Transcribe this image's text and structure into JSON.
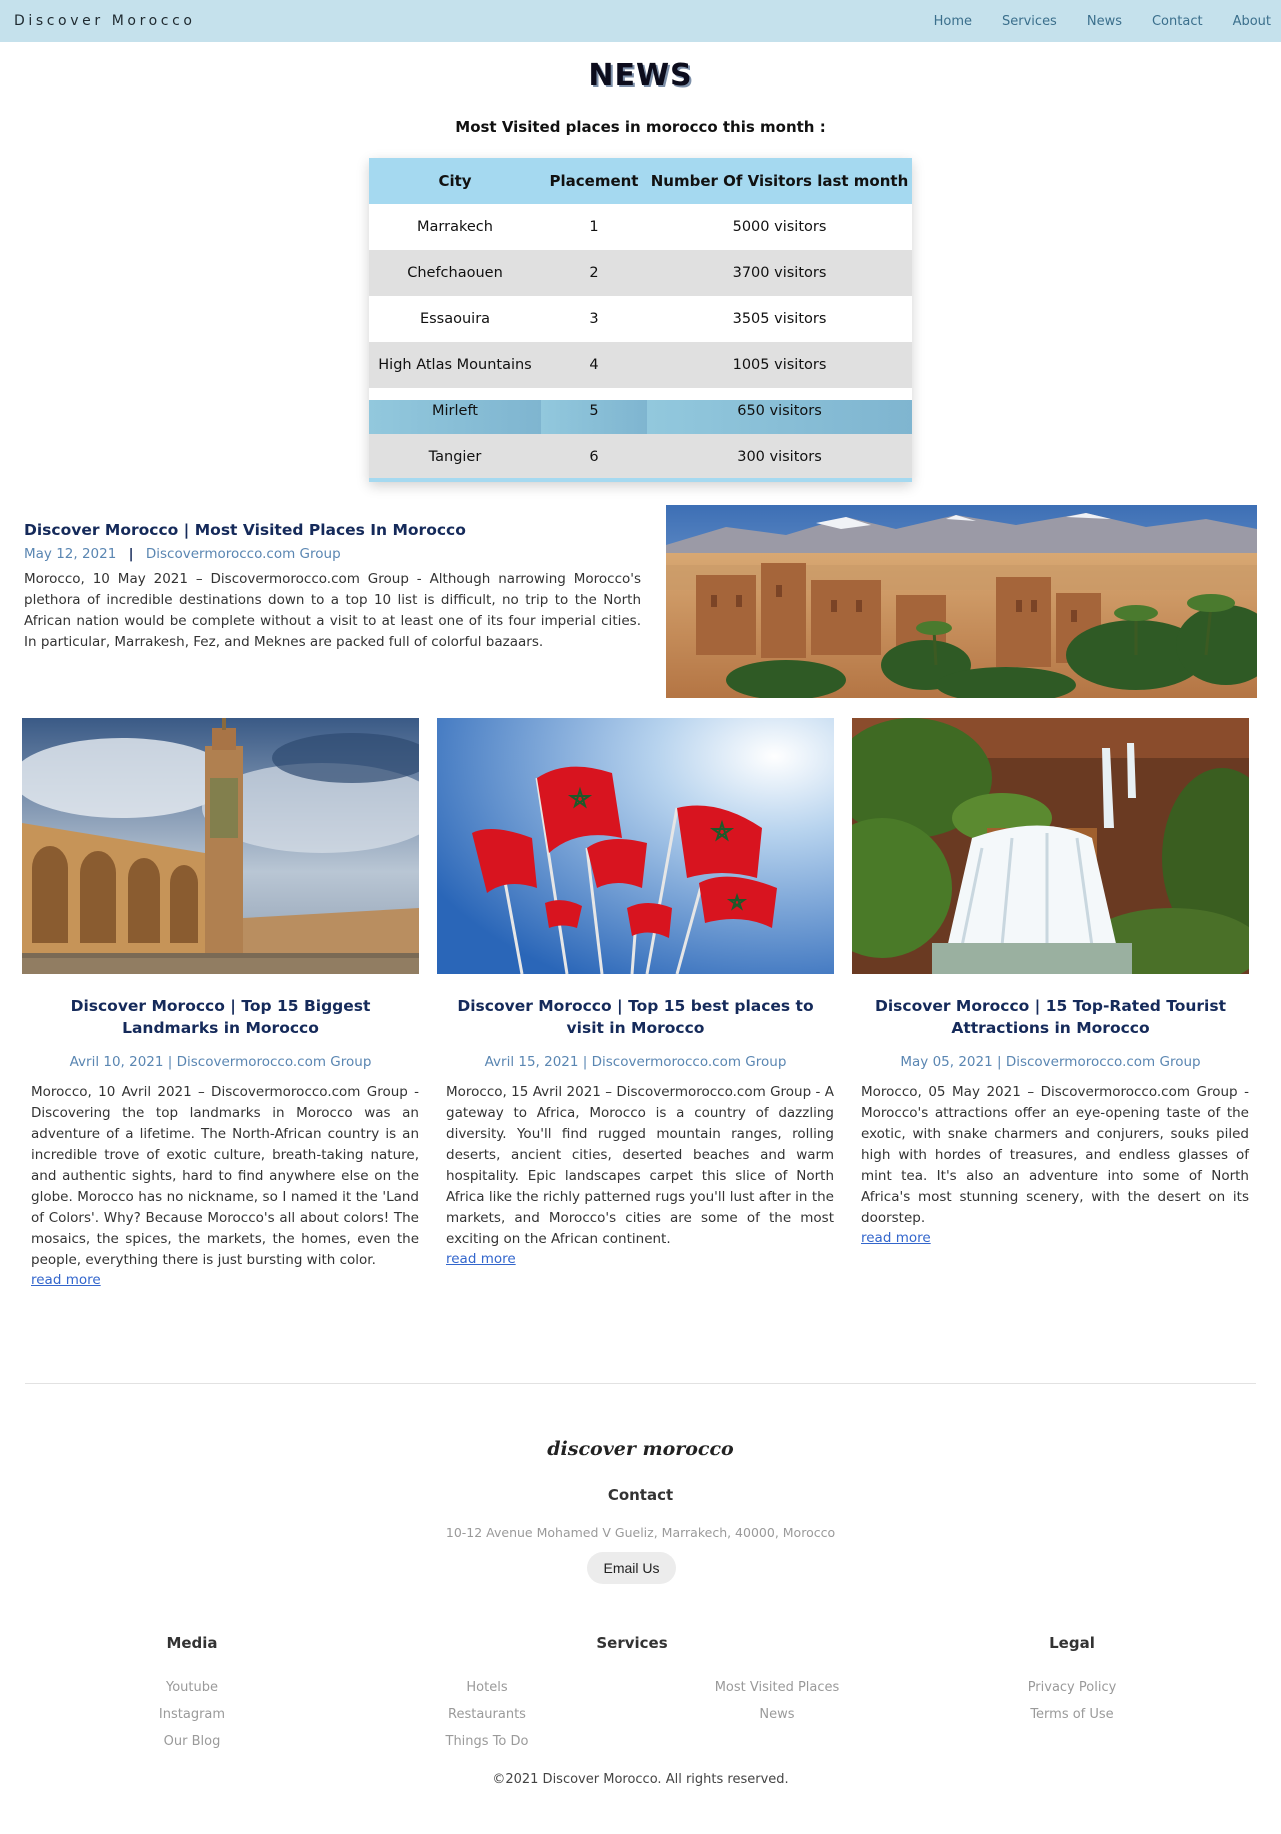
{
  "nav": {
    "brand": "Discover Morocco",
    "links": [
      "Home",
      "Services",
      "News",
      "Contact",
      "About"
    ]
  },
  "page": {
    "title": "NEWS",
    "subtitle": "Most Visited places in morocco this month :"
  },
  "table": {
    "headers": [
      "City",
      "Placement",
      "Number Of Visitors last month"
    ],
    "rows": [
      [
        "Marrakech",
        "1",
        "5000 visitors"
      ],
      [
        "Chefchaouen",
        "2",
        "3700 visitors"
      ],
      [
        "Essaouira",
        "3",
        "3505 visitors"
      ],
      [
        "High Atlas Mountains",
        "4",
        "1005 visitors"
      ],
      [
        "Mirleft",
        "5",
        "650 visitors"
      ],
      [
        "Tangier",
        "6",
        "300 visitors"
      ]
    ]
  },
  "feature": {
    "title": "Discover Morocco | Most Visited Places In Morocco",
    "date": "May 12, 2021",
    "separator": "|",
    "author": "Discovermorocco.com Group",
    "text": "Morocco, 10 May 2021 – Discovermorocco.com Group - Although narrowing Morocco's plethora of incredible destinations down to a top 10 list is difficult, no trip to the North African nation would be complete without a visit to at least one of its four imperial cities. In particular, Marrakesh, Fez, and Meknes are packed full of colorful bazaars."
  },
  "cards": [
    {
      "title": "Discover Morocco | Top 15 Biggest Landmarks in Morocco",
      "meta": "Avril 10, 2021 | Discovermorocco.com Group",
      "text": "Morocco, 10 Avril 2021 – Discovermorocco.com Group - Discovering the top landmarks in Morocco was an adventure of a lifetime. The North-African country is an incredible trove of exotic culture, breath-taking nature, and authentic sights, hard to find anywhere else on the globe. Morocco has no nickname, so I named it the 'Land of Colors'. Why? Because Morocco's all about colors! The mosaics, the spices, the markets, the homes, even the people, everything there is just bursting with color.",
      "link": "read more"
    },
    {
      "title": "Discover Morocco | Top 15 best places to visit in Morocco",
      "meta": "Avril 15, 2021 | Discovermorocco.com Group",
      "text": "Morocco, 15 Avril 2021 – Discovermorocco.com Group - A gateway to Africa, Morocco is a country of dazzling diversity. You'll find rugged mountain ranges, rolling deserts, ancient cities, deserted beaches and warm hospitality. Epic landscapes carpet this slice of North Africa like the richly patterned rugs you'll lust after in the markets, and Morocco's cities are some of the most exciting on the African continent.",
      "link": "read more"
    },
    {
      "title": "Discover Morocco | 15 Top-Rated Tourist Attractions in Morocco",
      "meta": "May 05, 2021 | Discovermorocco.com Group",
      "text": "Morocco, 05 May 2021 – Discovermorocco.com Group - Morocco's attractions offer an eye-opening taste of the exotic, with snake charmers and conjurers, souks piled high with hordes of treasures, and endless glasses of mint tea. It's also an adventure into some of North Africa's most stunning scenery, with the desert on its doorstep.",
      "link": "read more"
    }
  ],
  "footer": {
    "logo": "discover morocco",
    "contact_heading": "Contact",
    "address": "10-12 Avenue Mohamed V Gueliz, Marrakech, 40000, Morocco",
    "email_button": "Email Us",
    "media_heading": "Media",
    "media_links": [
      "Youtube",
      "Instagram",
      "Our Blog"
    ],
    "services_heading": "Services",
    "services_links_1": [
      "Hotels",
      "Restaurants",
      "Things To Do"
    ],
    "services_links_2": [
      "Most Visited Places",
      "News"
    ],
    "legal_heading": "Legal",
    "legal_links": [
      "Privacy Policy",
      "Terms of Use"
    ],
    "copyright": "©2021 Discover Morocco. All rights reserved."
  },
  "colors": {
    "nav_bg": "#c5e1ec",
    "table_header": "#a5d9f0",
    "row_grey": "#e0e0e0",
    "row_highlight": "#85bcd4",
    "title_color": "#152a5a",
    "meta_color": "#5a86b2",
    "link_color": "#3366cc"
  },
  "images": {
    "feature": "kasbah-desert-photo",
    "card1": "hassan-ii-mosque-photo",
    "card2": "moroccan-flags-photo",
    "card3": "ouzoud-waterfalls-photo"
  }
}
